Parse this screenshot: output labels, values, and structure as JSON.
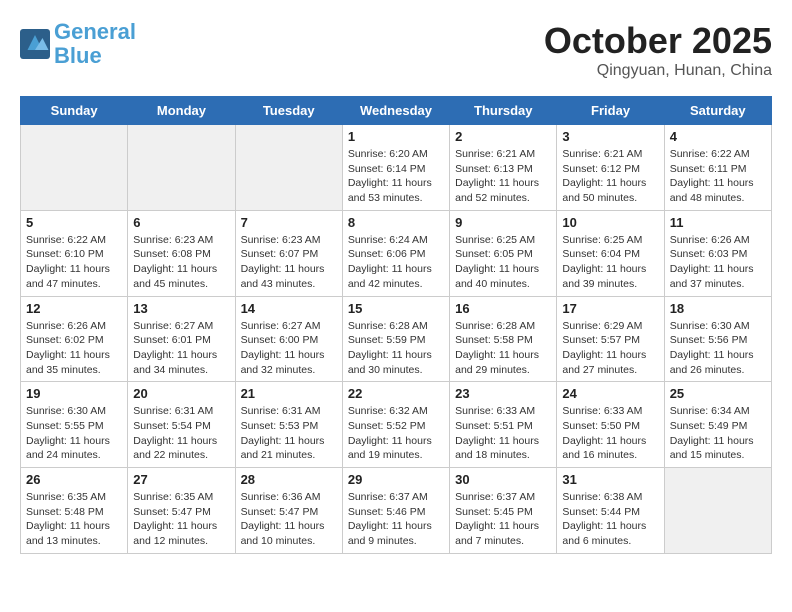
{
  "header": {
    "logo_line1": "General",
    "logo_line2": "Blue",
    "month": "October 2025",
    "location": "Qingyuan, Hunan, China"
  },
  "weekdays": [
    "Sunday",
    "Monday",
    "Tuesday",
    "Wednesday",
    "Thursday",
    "Friday",
    "Saturday"
  ],
  "weeks": [
    [
      {
        "day": "",
        "empty": true
      },
      {
        "day": "",
        "empty": true
      },
      {
        "day": "",
        "empty": true
      },
      {
        "day": "1",
        "info": "Sunrise: 6:20 AM\nSunset: 6:14 PM\nDaylight: 11 hours\nand 53 minutes."
      },
      {
        "day": "2",
        "info": "Sunrise: 6:21 AM\nSunset: 6:13 PM\nDaylight: 11 hours\nand 52 minutes."
      },
      {
        "day": "3",
        "info": "Sunrise: 6:21 AM\nSunset: 6:12 PM\nDaylight: 11 hours\nand 50 minutes."
      },
      {
        "day": "4",
        "info": "Sunrise: 6:22 AM\nSunset: 6:11 PM\nDaylight: 11 hours\nand 48 minutes."
      }
    ],
    [
      {
        "day": "5",
        "info": "Sunrise: 6:22 AM\nSunset: 6:10 PM\nDaylight: 11 hours\nand 47 minutes."
      },
      {
        "day": "6",
        "info": "Sunrise: 6:23 AM\nSunset: 6:08 PM\nDaylight: 11 hours\nand 45 minutes."
      },
      {
        "day": "7",
        "info": "Sunrise: 6:23 AM\nSunset: 6:07 PM\nDaylight: 11 hours\nand 43 minutes."
      },
      {
        "day": "8",
        "info": "Sunrise: 6:24 AM\nSunset: 6:06 PM\nDaylight: 11 hours\nand 42 minutes."
      },
      {
        "day": "9",
        "info": "Sunrise: 6:25 AM\nSunset: 6:05 PM\nDaylight: 11 hours\nand 40 minutes."
      },
      {
        "day": "10",
        "info": "Sunrise: 6:25 AM\nSunset: 6:04 PM\nDaylight: 11 hours\nand 39 minutes."
      },
      {
        "day": "11",
        "info": "Sunrise: 6:26 AM\nSunset: 6:03 PM\nDaylight: 11 hours\nand 37 minutes."
      }
    ],
    [
      {
        "day": "12",
        "info": "Sunrise: 6:26 AM\nSunset: 6:02 PM\nDaylight: 11 hours\nand 35 minutes."
      },
      {
        "day": "13",
        "info": "Sunrise: 6:27 AM\nSunset: 6:01 PM\nDaylight: 11 hours\nand 34 minutes."
      },
      {
        "day": "14",
        "info": "Sunrise: 6:27 AM\nSunset: 6:00 PM\nDaylight: 11 hours\nand 32 minutes."
      },
      {
        "day": "15",
        "info": "Sunrise: 6:28 AM\nSunset: 5:59 PM\nDaylight: 11 hours\nand 30 minutes."
      },
      {
        "day": "16",
        "info": "Sunrise: 6:28 AM\nSunset: 5:58 PM\nDaylight: 11 hours\nand 29 minutes."
      },
      {
        "day": "17",
        "info": "Sunrise: 6:29 AM\nSunset: 5:57 PM\nDaylight: 11 hours\nand 27 minutes."
      },
      {
        "day": "18",
        "info": "Sunrise: 6:30 AM\nSunset: 5:56 PM\nDaylight: 11 hours\nand 26 minutes."
      }
    ],
    [
      {
        "day": "19",
        "info": "Sunrise: 6:30 AM\nSunset: 5:55 PM\nDaylight: 11 hours\nand 24 minutes."
      },
      {
        "day": "20",
        "info": "Sunrise: 6:31 AM\nSunset: 5:54 PM\nDaylight: 11 hours\nand 22 minutes."
      },
      {
        "day": "21",
        "info": "Sunrise: 6:31 AM\nSunset: 5:53 PM\nDaylight: 11 hours\nand 21 minutes."
      },
      {
        "day": "22",
        "info": "Sunrise: 6:32 AM\nSunset: 5:52 PM\nDaylight: 11 hours\nand 19 minutes."
      },
      {
        "day": "23",
        "info": "Sunrise: 6:33 AM\nSunset: 5:51 PM\nDaylight: 11 hours\nand 18 minutes."
      },
      {
        "day": "24",
        "info": "Sunrise: 6:33 AM\nSunset: 5:50 PM\nDaylight: 11 hours\nand 16 minutes."
      },
      {
        "day": "25",
        "info": "Sunrise: 6:34 AM\nSunset: 5:49 PM\nDaylight: 11 hours\nand 15 minutes."
      }
    ],
    [
      {
        "day": "26",
        "info": "Sunrise: 6:35 AM\nSunset: 5:48 PM\nDaylight: 11 hours\nand 13 minutes."
      },
      {
        "day": "27",
        "info": "Sunrise: 6:35 AM\nSunset: 5:47 PM\nDaylight: 11 hours\nand 12 minutes."
      },
      {
        "day": "28",
        "info": "Sunrise: 6:36 AM\nSunset: 5:47 PM\nDaylight: 11 hours\nand 10 minutes."
      },
      {
        "day": "29",
        "info": "Sunrise: 6:37 AM\nSunset: 5:46 PM\nDaylight: 11 hours\nand 9 minutes."
      },
      {
        "day": "30",
        "info": "Sunrise: 6:37 AM\nSunset: 5:45 PM\nDaylight: 11 hours\nand 7 minutes."
      },
      {
        "day": "31",
        "info": "Sunrise: 6:38 AM\nSunset: 5:44 PM\nDaylight: 11 hours\nand 6 minutes."
      },
      {
        "day": "",
        "empty": true
      }
    ]
  ]
}
